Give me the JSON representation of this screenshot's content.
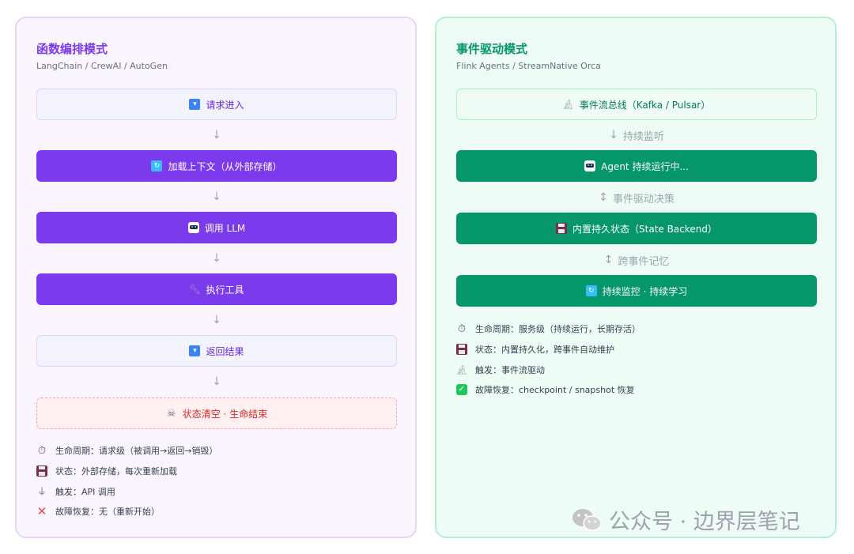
{
  "left": {
    "title": "函数编排模式",
    "subtitle": "LangChain / CrewAI / AutoGen",
    "steps": [
      {
        "icon": "inbox-tray-icon",
        "label": "请求进入"
      },
      {
        "icon": "refresh-icon",
        "label": "加载上下文（从外部存储）"
      },
      {
        "icon": "robot-icon",
        "label": "调用 LLM"
      },
      {
        "icon": "wrench-icon",
        "label": "执行工具"
      },
      {
        "icon": "inbox-tray-icon",
        "label": "返回结果"
      },
      {
        "icon": "skull-icon",
        "label": "状态清空 · 生命结束"
      }
    ],
    "arrows": [
      "↓",
      "↓",
      "↓",
      "↓",
      "↓"
    ],
    "info": [
      {
        "icon": "timer-icon",
        "text": "生命周期：请求级（被调用→返回→销毁）"
      },
      {
        "icon": "floppy-disk-icon",
        "text": "状态：外部存储，每次重新加载"
      },
      {
        "icon": "plug-icon",
        "text": "触发：API 调用"
      },
      {
        "icon": "cross-mark-icon",
        "text": "故障恢复：无（重新开始）"
      }
    ]
  },
  "right": {
    "title": "事件驱动模式",
    "subtitle": "Flink Agents / StreamNative Orca",
    "steps": [
      {
        "icon": "microscope-icon",
        "label": "事件流总线（Kafka / Pulsar）"
      },
      {
        "icon": "robot-icon",
        "label": "Agent 持续运行中..."
      },
      {
        "icon": "floppy-disk-icon",
        "label": "内置持久状态（State Backend）"
      },
      {
        "icon": "refresh-icon",
        "label": "持续监控 · 持续学习"
      }
    ],
    "arrows": [
      {
        "glyph": "↓",
        "label": "持续监听"
      },
      {
        "glyph": "↕",
        "label": "事件驱动决策"
      },
      {
        "glyph": "↕",
        "label": "跨事件记忆"
      }
    ],
    "info": [
      {
        "icon": "timer-icon",
        "text": "生命周期：服务级（持续运行，长期存活）"
      },
      {
        "icon": "floppy-disk-icon",
        "text": "状态：内置持久化，跨事件自动维护"
      },
      {
        "icon": "microscope-icon",
        "text": "触发：事件流驱动"
      },
      {
        "icon": "check-mark-icon",
        "text": "故障恢复：checkpoint / snapshot 恢复"
      }
    ]
  },
  "watermark": {
    "text": "公众号 · 边界层笔记"
  },
  "colors": {
    "left_accent": "#7c3aed",
    "right_accent": "#059669",
    "danger": "#dc2626"
  }
}
